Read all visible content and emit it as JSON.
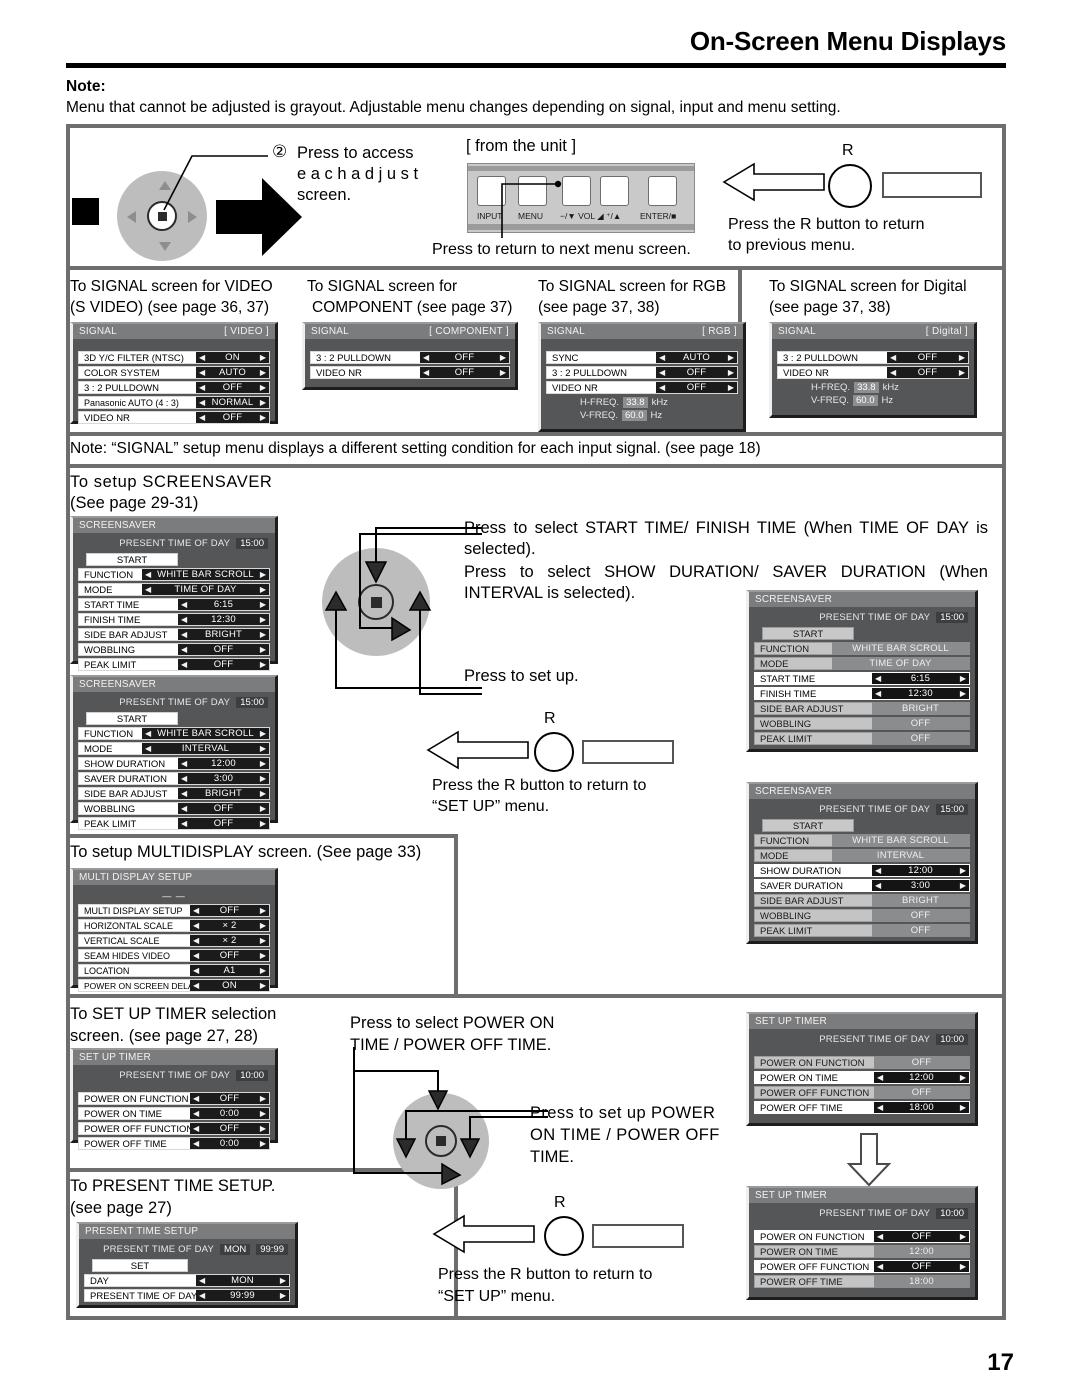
{
  "header": {
    "title": "On-Screen Menu Displays",
    "note_label": "Note:",
    "note_text": "Menu that cannot be adjusted is grayout. Adjustable menu changes depending on signal, input and menu setting."
  },
  "page_number": "17",
  "top_section": {
    "step_number": "②",
    "step_text_line1": "Press to access",
    "step_text_line2": "e a c h    a d j u s t",
    "step_text_line3": "screen.",
    "unit_caption": "[ from the unit ]",
    "unit_buttons": [
      "INPUT",
      "MENU",
      "−/▼ VOL ◢ ⁺/▲",
      "ENTER/■"
    ],
    "unit_note": "Press to return to next menu screen.",
    "r_label": "R",
    "r_note_line1": "Press the R button to return",
    "r_note_line2": "to previous menu."
  },
  "signal_section": {
    "captions": [
      {
        "line1": "To SIGNAL screen for VIDEO",
        "line2": "(S VIDEO) (see page 36, 37)"
      },
      {
        "line1": "To SIGNAL screen for",
        "line2": "COMPONENT (see page 37)"
      },
      {
        "line1": "To SIGNAL screen for RGB",
        "line2": "(see page 37, 38)"
      },
      {
        "line1": "To SIGNAL screen for Digital",
        "line2": "(see page 37, 38)"
      }
    ],
    "note": "Note:  “SIGNAL” setup menu displays a different setting condition for each input signal. (see page 18)",
    "panels": [
      {
        "title": "SIGNAL",
        "tag": "[ VIDEO ]",
        "rows": [
          {
            "label": "3D Y/C FILTER (NTSC)",
            "value": "ON"
          },
          {
            "label": "COLOR SYSTEM",
            "value": "AUTO"
          },
          {
            "label": "3 : 2 PULLDOWN",
            "value": "OFF"
          },
          {
            "label": "Panasonic AUTO (4 : 3)",
            "value": "NORMAL"
          },
          {
            "label": "VIDEO NR",
            "value": "OFF"
          }
        ],
        "freqs": []
      },
      {
        "title": "SIGNAL",
        "tag": "[ COMPONENT ]",
        "rows": [
          {
            "label": "3 : 2 PULLDOWN",
            "value": "OFF"
          },
          {
            "label": "VIDEO NR",
            "value": "OFF"
          }
        ],
        "freqs": []
      },
      {
        "title": "SIGNAL",
        "tag": "[ RGB ]",
        "rows": [
          {
            "label": "SYNC",
            "value": "AUTO"
          },
          {
            "label": "3 : 2 PULLDOWN",
            "value": "OFF"
          },
          {
            "label": "VIDEO NR",
            "value": "OFF"
          }
        ],
        "freqs": [
          {
            "label": "H-FREQ.",
            "value": "33.8",
            "unit": "kHz"
          },
          {
            "label": "V-FREQ.",
            "value": "60.0",
            "unit": "Hz"
          }
        ]
      },
      {
        "title": "SIGNAL",
        "tag": "[ Digital ]",
        "rows": [
          {
            "label": "3 : 2 PULLDOWN",
            "value": "OFF"
          },
          {
            "label": "VIDEO NR",
            "value": "OFF"
          }
        ],
        "freqs": [
          {
            "label": "H-FREQ.",
            "value": "33.8",
            "unit": "kHz"
          },
          {
            "label": "V-FREQ.",
            "value": "60.0",
            "unit": "Hz"
          }
        ]
      }
    ]
  },
  "screensaver_section": {
    "caption_line1": "To setup SCREENSAVER",
    "caption_line2": "(See page 29-31)",
    "instruction1": "Press to select START TIME/ FINISH TIME (When TIME OF DAY is selected).",
    "instruction2": "Press to select SHOW DURATION/ SAVER DURATION (When INTERVAL is selected).",
    "instruction3": "Press to set up.",
    "r_label": "R",
    "r_note_line1": "Press the R button to return to",
    "r_note_line2": "“SET UP” menu.",
    "panel_timeofday": {
      "title": "SCREENSAVER",
      "present_label": "PRESENT  TIME OF DAY",
      "present_value": "15:00",
      "start_button": "START",
      "rows": [
        {
          "label": "FUNCTION",
          "value": "WHITE BAR SCROLL"
        },
        {
          "label": "MODE",
          "value": "TIME OF DAY"
        },
        {
          "label": "START TIME",
          "value": "6:15"
        },
        {
          "label": "FINISH TIME",
          "value": "12:30"
        },
        {
          "label": "SIDE BAR ADJUST",
          "value": "BRIGHT"
        },
        {
          "label": "WOBBLING",
          "value": "OFF"
        },
        {
          "label": "PEAK LIMIT",
          "value": "OFF"
        }
      ]
    },
    "panel_interval": {
      "title": "SCREENSAVER",
      "present_label": "PRESENT  TIME OF DAY",
      "present_value": "15:00",
      "start_button": "START",
      "rows": [
        {
          "label": "FUNCTION",
          "value": "WHITE BAR SCROLL"
        },
        {
          "label": "MODE",
          "value": "INTERVAL"
        },
        {
          "label": "SHOW DURATION",
          "value": "12:00"
        },
        {
          "label": "SAVER DURATION",
          "value": "3:00"
        },
        {
          "label": "SIDE BAR ADJUST",
          "value": "BRIGHT"
        },
        {
          "label": "WOBBLING",
          "value": "OFF"
        },
        {
          "label": "PEAK LIMIT",
          "value": "OFF"
        }
      ]
    },
    "panel_timeofday_selected": {
      "title": "SCREENSAVER",
      "present_label": "PRESENT  TIME OF DAY",
      "present_value": "15:00",
      "start_button": "START",
      "rows": [
        {
          "label": "FUNCTION",
          "value": "WHITE BAR SCROLL",
          "state": "gray"
        },
        {
          "label": "MODE",
          "value": "TIME OF DAY",
          "state": "gray"
        },
        {
          "label": "START TIME",
          "value": "6:15",
          "state": "active"
        },
        {
          "label": "FINISH TIME",
          "value": "12:30",
          "state": "active"
        },
        {
          "label": "SIDE BAR ADJUST",
          "value": "BRIGHT",
          "state": "gray"
        },
        {
          "label": "WOBBLING",
          "value": "OFF",
          "state": "gray"
        },
        {
          "label": "PEAK LIMIT",
          "value": "OFF",
          "state": "gray"
        }
      ]
    },
    "panel_interval_selected": {
      "title": "SCREENSAVER",
      "present_label": "PRESENT  TIME OF DAY",
      "present_value": "15:00",
      "start_button": "START",
      "rows": [
        {
          "label": "FUNCTION",
          "value": "WHITE BAR SCROLL",
          "state": "gray"
        },
        {
          "label": "MODE",
          "value": "INTERVAL",
          "state": "gray"
        },
        {
          "label": "SHOW DURATION",
          "value": "12:00",
          "state": "active"
        },
        {
          "label": "SAVER DURATION",
          "value": "3:00",
          "state": "active"
        },
        {
          "label": "SIDE BAR ADJUST",
          "value": "BRIGHT",
          "state": "gray"
        },
        {
          "label": "WOBBLING",
          "value": "OFF",
          "state": "gray"
        },
        {
          "label": "PEAK LIMIT",
          "value": "OFF",
          "state": "gray"
        }
      ]
    }
  },
  "multidisplay_section": {
    "caption": "To setup MULTIDISPLAY screen. (See page 33)",
    "panel": {
      "title": "MULTI DISPLAY SETUP",
      "dash": "— —",
      "rows": [
        {
          "label": "MULTI DISPLAY SETUP",
          "value": "OFF"
        },
        {
          "label": "HORIZONTAL SCALE",
          "value": "× 2"
        },
        {
          "label": "VERTICAL SCALE",
          "value": "× 2"
        },
        {
          "label": "SEAM HIDES VIDEO",
          "value": "OFF"
        },
        {
          "label": "LOCATION",
          "value": "A1"
        },
        {
          "label": "POWER ON SCREEN DELAY",
          "value": "ON"
        }
      ]
    }
  },
  "timer_section": {
    "caption_line1": "To SET UP TIMER selection",
    "caption_line2": "screen. (see page 27, 28)",
    "instruction1_line1": "Press to select POWER ON",
    "instruction1_line2": "TIME / POWER OFF TIME.",
    "instruction2_line1": "Press to set up POWER",
    "instruction2_line2": "ON TIME / POWER OFF",
    "instruction2_line3": "TIME.",
    "r_label": "R",
    "r_note_line1": "Press the R button to return to",
    "r_note_line2": "“SET UP” menu.",
    "panel_default": {
      "title": "SET UP TIMER",
      "present_label": "PRESENT  TIME OF DAY",
      "present_value": "10:00",
      "rows": [
        {
          "label": "POWER ON FUNCTION",
          "value": "OFF"
        },
        {
          "label": "POWER ON TIME",
          "value": "0:00"
        },
        {
          "label": "POWER OFF FUNCTION",
          "value": "OFF"
        },
        {
          "label": "POWER OFF TIME",
          "value": "0:00"
        }
      ]
    },
    "panel_time_selected": {
      "title": "SET UP TIMER",
      "present_label": "PRESENT  TIME OF DAY",
      "present_value": "10:00",
      "rows": [
        {
          "label": "POWER ON FUNCTION",
          "value": "OFF",
          "state": "gray"
        },
        {
          "label": "POWER ON TIME",
          "value": "12:00",
          "state": "active"
        },
        {
          "label": "POWER OFF FUNCTION",
          "value": "OFF",
          "state": "gray"
        },
        {
          "label": "POWER OFF TIME",
          "value": "18:00",
          "state": "active"
        }
      ]
    },
    "panel_function_selected": {
      "title": "SET UP TIMER",
      "present_label": "PRESENT  TIME OF DAY",
      "present_value": "10:00",
      "rows": [
        {
          "label": "POWER ON FUNCTION",
          "value": "OFF",
          "state": "active"
        },
        {
          "label": "POWER ON TIME",
          "value": "12:00",
          "state": "gray"
        },
        {
          "label": "POWER OFF FUNCTION",
          "value": "OFF",
          "state": "active"
        },
        {
          "label": "POWER OFF TIME",
          "value": "18:00",
          "state": "gray"
        }
      ]
    }
  },
  "present_time_section": {
    "caption_line1": "To PRESENT TIME SETUP.",
    "caption_line2": "(see page 27)",
    "panel": {
      "title": "PRESENT  TIME SETUP",
      "present_label": "PRESENT  TIME OF DAY",
      "present_day": "MON",
      "present_value": "99:99",
      "set_button": "SET",
      "rows": [
        {
          "label": "DAY",
          "value": "MON"
        },
        {
          "label": "PRESENT  TIME OF DAY",
          "value": "99:99"
        }
      ]
    }
  }
}
